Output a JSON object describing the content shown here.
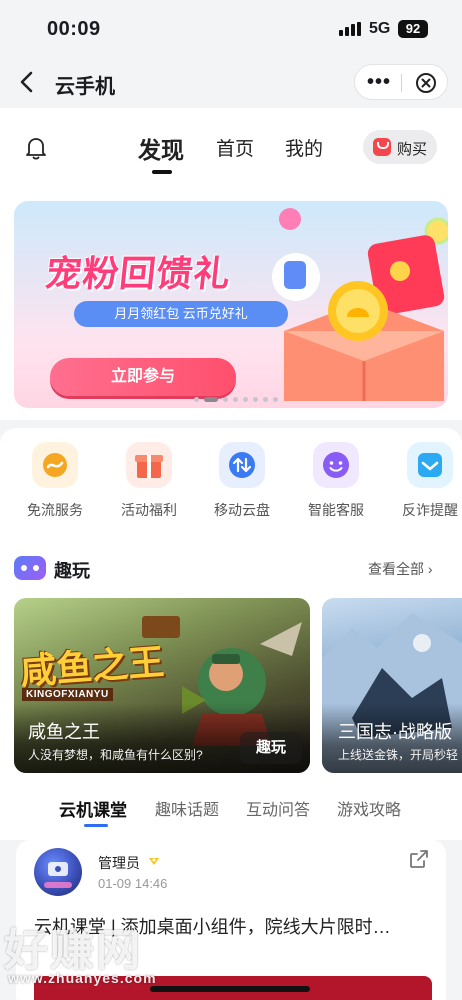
{
  "status_bar": {
    "time": "00:09",
    "network": "5G",
    "battery": "92"
  },
  "nav": {
    "title": "云手机",
    "more_label": "•••"
  },
  "tabs": [
    {
      "label": "发现",
      "active": true
    },
    {
      "label": "首页",
      "active": false
    },
    {
      "label": "我的",
      "active": false
    }
  ],
  "buy_label": "购买",
  "banner": {
    "title": "宠粉回馈礼",
    "pill": "月月领红包  云币兑好礼",
    "cta": "立即参与",
    "slide_count": 8,
    "active_slide": 2
  },
  "services": [
    {
      "label": "免流服务",
      "icon": "flow-icon",
      "color": "#f5a623"
    },
    {
      "label": "活动福利",
      "icon": "gift-icon",
      "color": "#f4674a"
    },
    {
      "label": "移动云盘",
      "icon": "cloud-drive-icon",
      "color": "#3a7af2"
    },
    {
      "label": "智能客服",
      "icon": "service-bot-icon",
      "color": "#8a5cf6"
    },
    {
      "label": "反诈提醒",
      "icon": "shield-icon",
      "color": "#2ba9f2"
    }
  ],
  "fun": {
    "title": "趣玩",
    "see_all": "查看全部 ›",
    "games": [
      {
        "logo": "咸鱼之王",
        "logo_en": "KINGOFXIANYU",
        "name": "咸鱼之王",
        "desc": "人没有梦想，和咸鱼有什么区别?",
        "action": "趣玩"
      },
      {
        "name": "三国志·战略版",
        "desc": "上线送金铢，开局秒轻"
      }
    ]
  },
  "subtabs": [
    {
      "label": "云机课堂",
      "active": true
    },
    {
      "label": "趣味话题",
      "active": false
    },
    {
      "label": "互动问答",
      "active": false
    },
    {
      "label": "游戏攻略",
      "active": false
    }
  ],
  "post": {
    "author": "管理员",
    "time": "01-09 14:46",
    "title": "云机课堂 | 添加桌面小组件，院线大片限时…"
  },
  "watermark": {
    "main": "好赚网",
    "url": "www.zhuanyes.com"
  }
}
